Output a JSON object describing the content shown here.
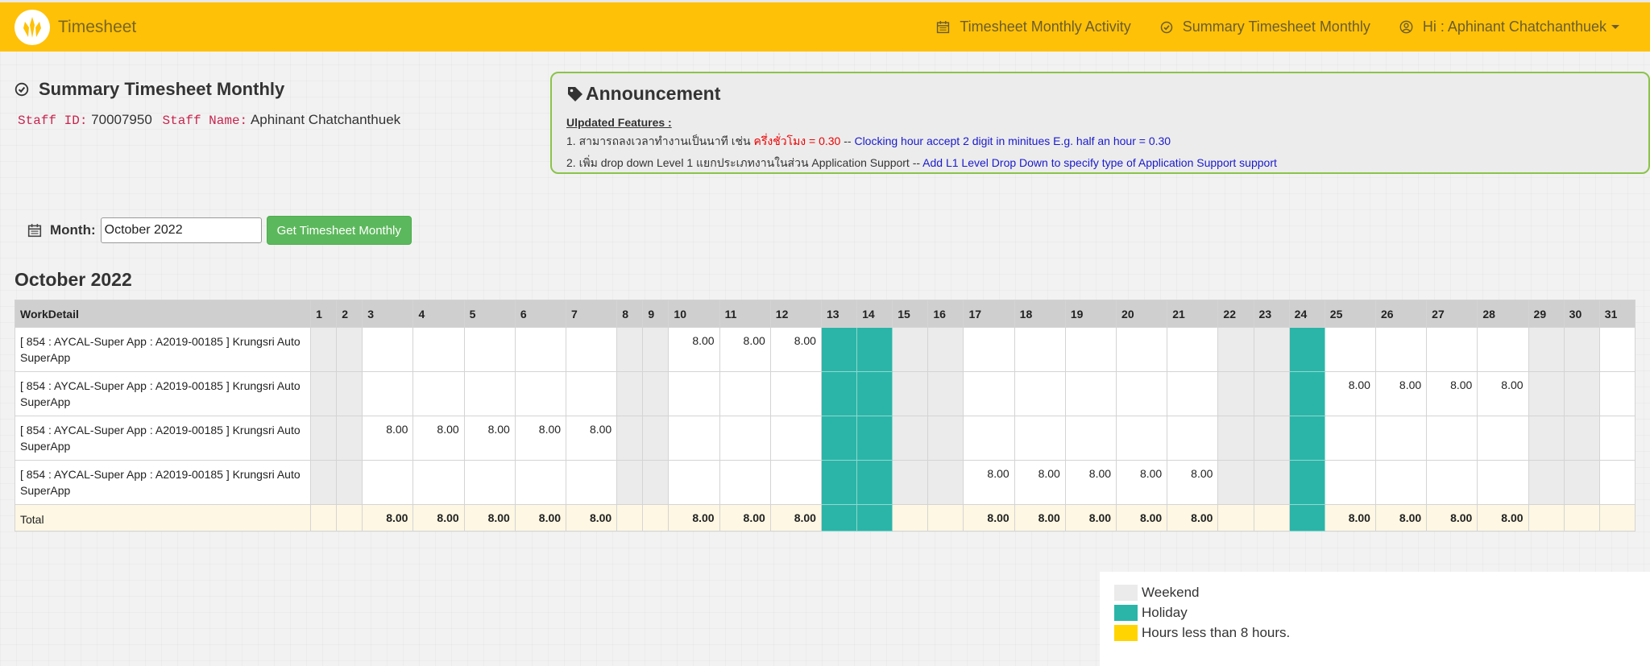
{
  "nav": {
    "brand": "Timesheet",
    "links": [
      {
        "icon": "calendar-icon",
        "label": "Timesheet Monthly Activity"
      },
      {
        "icon": "check-circle-icon",
        "label": "Summary Timesheet Monthly"
      },
      {
        "icon": "user-circle-icon",
        "label": "Hi : Aphinant Chatchanthuek"
      }
    ]
  },
  "header": {
    "title": "Summary Timesheet Monthly",
    "staff_id_label": "Staff ID:",
    "staff_id": "70007950",
    "staff_name_label": "Staff Name:",
    "staff_name": "Aphinant Chatchanthuek"
  },
  "announcement": {
    "title": "Announcement",
    "subtitle": "Ulpdated Features :",
    "line1_thai": "1. สามารถลงเวลาทำงานเป็นนาที เช่น ",
    "line1_red": "ครึ่งชั่วโมง = 0.30",
    "line1_sep": " -- ",
    "line1_en": "Clocking hour accept 2 digit in minitues E.g. half an hour = 0.30",
    "line2_thai": "2. เพิ่ม drop down Level 1 แยกประเภทงานในส่วน Application Support",
    "line2_sep": " -- ",
    "line2_en": "Add L1 Level Drop Down to specify type of Application Support support"
  },
  "filter": {
    "month_label": "Month:",
    "month_value": "October 2022",
    "button": "Get Timesheet Monthly"
  },
  "table": {
    "title": "October 2022",
    "first_header": "WorkDetail",
    "total_label": "Total",
    "weekends": [
      1,
      2,
      8,
      9,
      15,
      16,
      22,
      23,
      29,
      30
    ],
    "holidays": [
      13,
      14,
      24
    ],
    "rows": [
      {
        "detail": "[ 854 : AYCAL-Super App : A2019-00185 ] Krungsri Auto SuperApp",
        "hours": {
          "10": "8.00",
          "11": "8.00",
          "12": "8.00"
        }
      },
      {
        "detail": "[ 854 : AYCAL-Super App : A2019-00185 ] Krungsri Auto SuperApp",
        "hours": {
          "25": "8.00",
          "26": "8.00",
          "27": "8.00",
          "28": "8.00"
        }
      },
      {
        "detail": "[ 854 : AYCAL-Super App : A2019-00185 ] Krungsri Auto SuperApp",
        "hours": {
          "3": "8.00",
          "4": "8.00",
          "5": "8.00",
          "6": "8.00",
          "7": "8.00"
        }
      },
      {
        "detail": "[ 854 : AYCAL-Super App : A2019-00185 ] Krungsri Auto SuperApp",
        "hours": {
          "17": "8.00",
          "18": "8.00",
          "19": "8.00",
          "20": "8.00",
          "21": "8.00"
        }
      }
    ],
    "totals": {
      "3": "8.00",
      "4": "8.00",
      "5": "8.00",
      "6": "8.00",
      "7": "8.00",
      "10": "8.00",
      "11": "8.00",
      "12": "8.00",
      "17": "8.00",
      "18": "8.00",
      "19": "8.00",
      "20": "8.00",
      "21": "8.00",
      "25": "8.00",
      "26": "8.00",
      "27": "8.00",
      "28": "8.00"
    }
  },
  "legend": {
    "items": [
      {
        "label": "Weekend",
        "color": "#ebebeb"
      },
      {
        "label": "Holiday",
        "color": "#2bb5a8"
      },
      {
        "label": "Hours less than 8 hours.",
        "color": "#ffd400"
      }
    ]
  }
}
